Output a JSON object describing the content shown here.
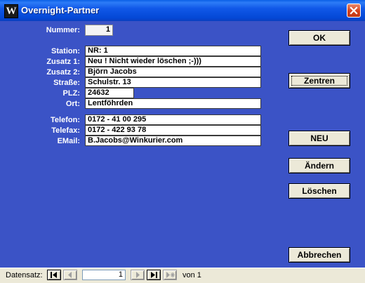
{
  "window": {
    "title": "Overnight-Partner",
    "app_icon_letter": "W"
  },
  "fields": {
    "nummer": {
      "label": "Nummer:",
      "value": "1"
    },
    "station": {
      "label": "Station:",
      "value": "NR: 1"
    },
    "zusatz1": {
      "label": "Zusatz 1:",
      "value": "Neu ! Nicht wieder löschen ;-)))"
    },
    "zusatz2": {
      "label": "Zusatz 2:",
      "value": "Björn Jacobs"
    },
    "strasse": {
      "label": "Straße:",
      "value": "Schulstr. 13"
    },
    "plz": {
      "label": "PLZ:",
      "value": "24632"
    },
    "ort": {
      "label": "Ort:",
      "value": "Lentföhrden"
    },
    "telefon": {
      "label": "Telefon:",
      "value": "0172 - 41 00 295"
    },
    "telefax": {
      "label": "Telefax:",
      "value": "0172 - 422 93 78"
    },
    "email": {
      "label": "EMail:",
      "value": "B.Jacobs@Winkurier.com"
    }
  },
  "buttons": {
    "ok": "OK",
    "zentren": "Zentren",
    "neu": "NEU",
    "aendern": "Ändern",
    "loeschen": "Löschen",
    "abbrechen": "Abbrechen"
  },
  "navigator": {
    "label": "Datensatz:",
    "current_record": "1",
    "of_text": "von  1"
  },
  "colors": {
    "background": "#3b53c6",
    "titlebar": "#0a5fe6",
    "close": "#d6401b"
  }
}
